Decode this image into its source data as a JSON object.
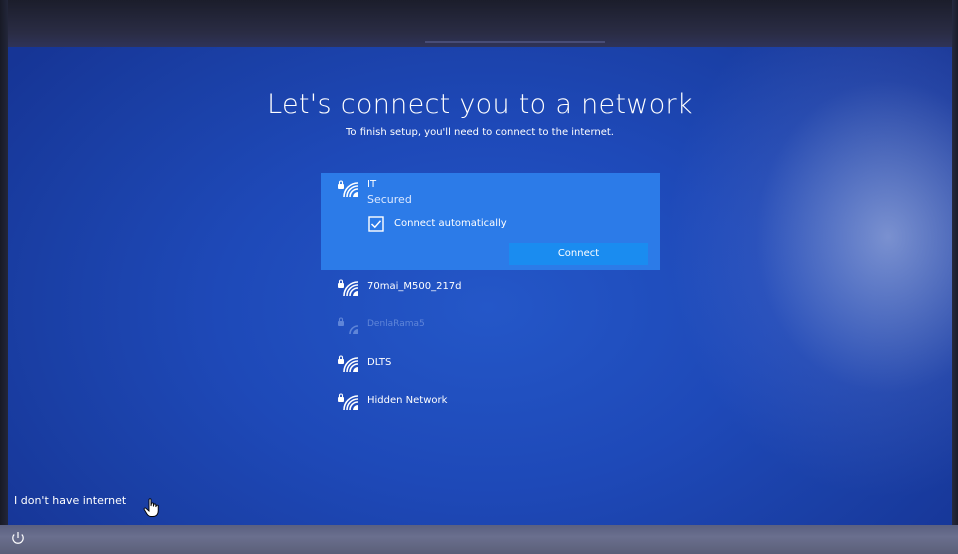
{
  "page": {
    "title": "Let's connect you to a network",
    "subtitle": "To finish setup, you'll need to connect to the internet."
  },
  "networks": [
    {
      "name": "IT",
      "status": "Secured",
      "selected": true,
      "connect_automatically_label": "Connect automatically",
      "connect_automatically_checked": true,
      "connect_label": "Connect",
      "icon": "wifi-secured-icon"
    },
    {
      "name": "70mai_M500_217d",
      "icon": "wifi-secured-icon"
    },
    {
      "name": "DenlaRama5",
      "icon": "wifi-secured-icon",
      "dimmed": true
    },
    {
      "name": "DLTS",
      "icon": "wifi-secured-icon"
    },
    {
      "name": "Hidden Network",
      "icon": "wifi-secured-icon"
    }
  ],
  "skip_link": "I don't have internet",
  "taskbar": {
    "icon": "power-icon"
  },
  "colors": {
    "background": "#1e49b8",
    "selected_item": "#2c7be8",
    "button": "#1a8cf0",
    "text": "#ffffff"
  }
}
